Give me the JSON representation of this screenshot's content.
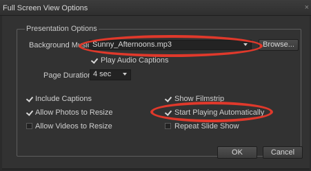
{
  "window": {
    "title": "Full Screen View Options",
    "close_glyph": "×"
  },
  "group": {
    "label": "Presentation Options"
  },
  "background_music": {
    "label": "Background Music:",
    "value": "Sunny_Afternoons.mp3",
    "browse_label": "Browse..."
  },
  "play_audio_captions": {
    "label": "Play Audio Captions",
    "checked": true
  },
  "page_duration": {
    "label": "Page Duration:",
    "value": "4 sec"
  },
  "options": {
    "include_captions": {
      "label": "Include Captions",
      "checked": true
    },
    "allow_photos_resize": {
      "label": "Allow Photos to Resize",
      "checked": true
    },
    "allow_videos_resize": {
      "label": "Allow Videos to Resize",
      "checked": false
    },
    "show_filmstrip": {
      "label": "Show Filmstrip",
      "checked": true
    },
    "start_playing": {
      "label": "Start Playing Automatically",
      "checked": true
    },
    "repeat_slideshow": {
      "label": "Repeat Slide Show",
      "checked": false
    }
  },
  "buttons": {
    "ok": "OK",
    "cancel": "Cancel"
  },
  "annotation_color": "#e0392b"
}
